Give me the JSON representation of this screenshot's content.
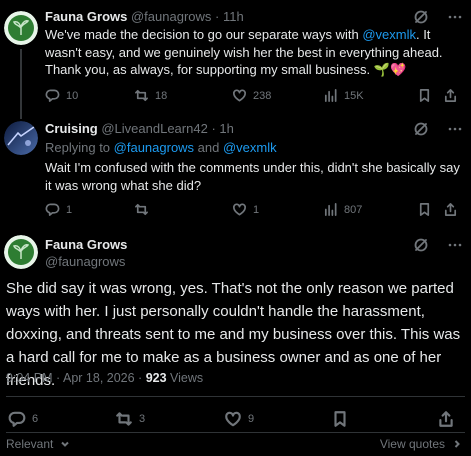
{
  "tweets": [
    {
      "name": "Fauna Grows",
      "handle": "@faunagrows",
      "sep": "·",
      "time": "11h",
      "text_parts": [
        "We've made the decision to go our separate ways with ",
        "@vexmlk",
        ". It wasn't easy, and we genuinely wish her the best in everything ahead. Thank you, as always, for supporting my small business. 🌱💖"
      ],
      "reply": "10",
      "retweet": "18",
      "like": "238",
      "views": "15K",
      "avatar_color": "#1b5e20"
    },
    {
      "name": "Cruising",
      "handle": "@LiveandLearn42",
      "sep": "·",
      "time": "1h",
      "replying_to_label": "Replying to ",
      "replying_to_a": "@faunagrows",
      "replying_and": " and ",
      "replying_to_b": "@vexmlk",
      "text": "Wait I'm confused with the comments under this, didn't she basically say it was wrong what she did?",
      "reply": "1",
      "retweet": "",
      "like": "1",
      "views": "807"
    }
  ],
  "main": {
    "name": "Fauna Grows",
    "handle": "@faunagrows",
    "text": "She did say it was wrong, yes. That's not the only reason we parted ways with her. I just personally couldn't handle the harassment, doxxing, and threats sent to me and my business over this. This was a hard call for me to make as a business owner and as one of her friends.",
    "time": "9:04 PM",
    "date_sep": " · ",
    "date": "Apr 18, 2026",
    "views_count": "923",
    "views_label": "Views",
    "reply": "6",
    "retweet": "3",
    "like": "9"
  },
  "footer": {
    "sort_label": "Relevant",
    "quotes_label": "View quotes"
  },
  "colors": {
    "accent": "#1d9bf0",
    "muted": "#71767b",
    "background": "#000000"
  }
}
